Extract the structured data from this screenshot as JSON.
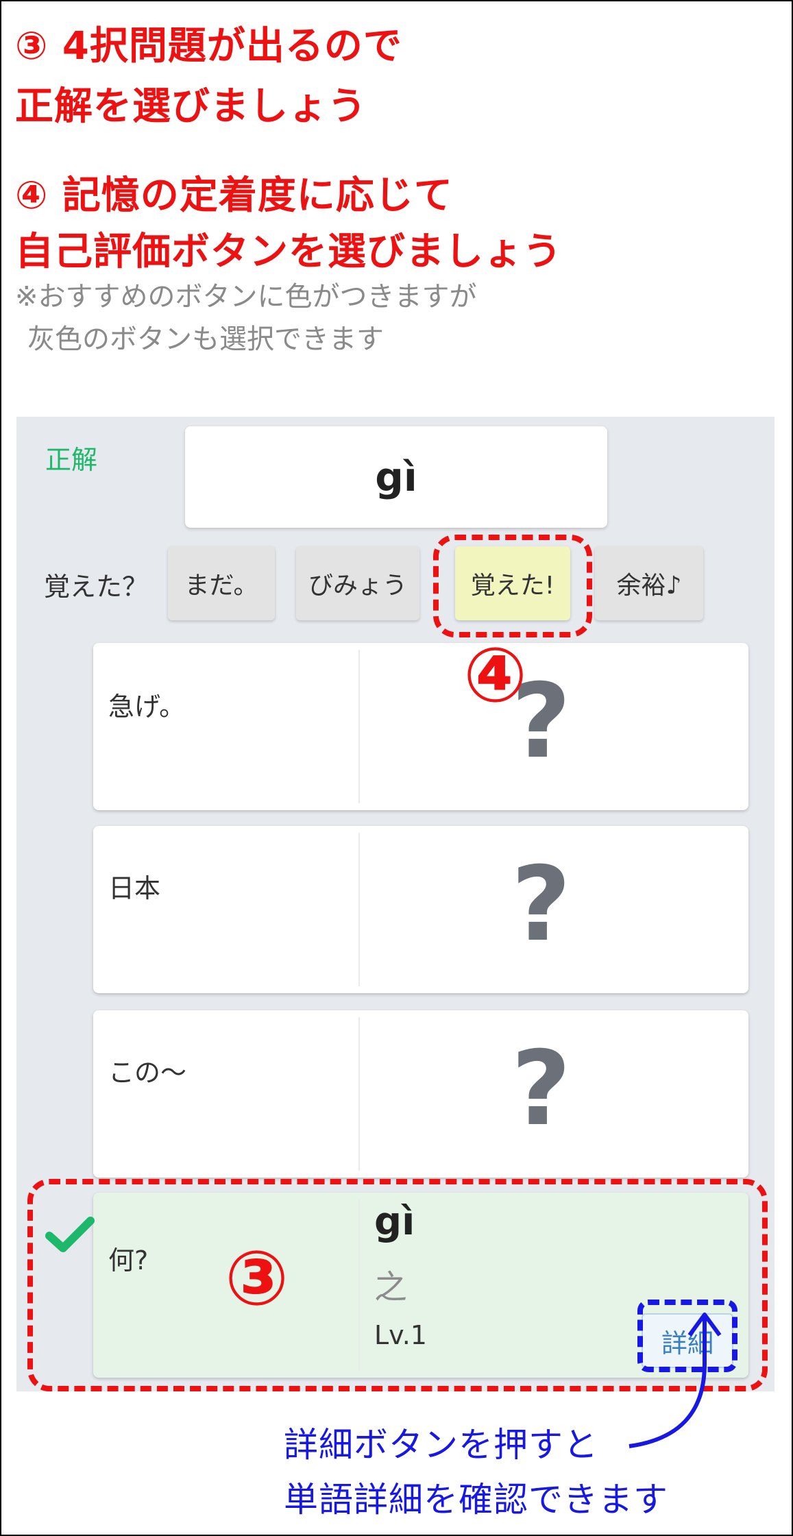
{
  "instructions": {
    "step3_line1": "③ 4択問題が出るので",
    "step3_line2": "正解を選びましょう",
    "step4_line1": "④ 記憶の定着度に応じて",
    "step4_line2": "自己評価ボタンを選びましょう",
    "note_line1": "※おすすめのボタンに色がつきますが",
    "note_line2": "灰色のボタンも選択できます"
  },
  "answer": {
    "label": "正解",
    "value": "gì"
  },
  "rating": {
    "question": "覚えた？",
    "buttons": [
      "まだ。",
      "びみょう",
      "覚えた!",
      "余裕♪"
    ],
    "highlighted_index": 2
  },
  "choices": [
    {
      "word": "急げ。",
      "hidden": "?"
    },
    {
      "word": "日本",
      "hidden": "?"
    },
    {
      "word": "この〜",
      "hidden": "?"
    },
    {
      "word": "何?",
      "pinyin": "gì",
      "hanzi": "之",
      "level": "Lv.1",
      "detail_label": "詳細",
      "selected": true
    }
  ],
  "annotations": {
    "marker_4": "④",
    "marker_3": "③",
    "detail_note_line1": "詳細ボタンを押すと",
    "detail_note_line2": "単語詳細を確認できます"
  },
  "colors": {
    "instruction_red": "#ee1111",
    "note_blue": "#1717e6",
    "correct_green": "#1db86a",
    "selected_card": "#e6f4e7",
    "highlight_button": "#f3f5bf"
  }
}
